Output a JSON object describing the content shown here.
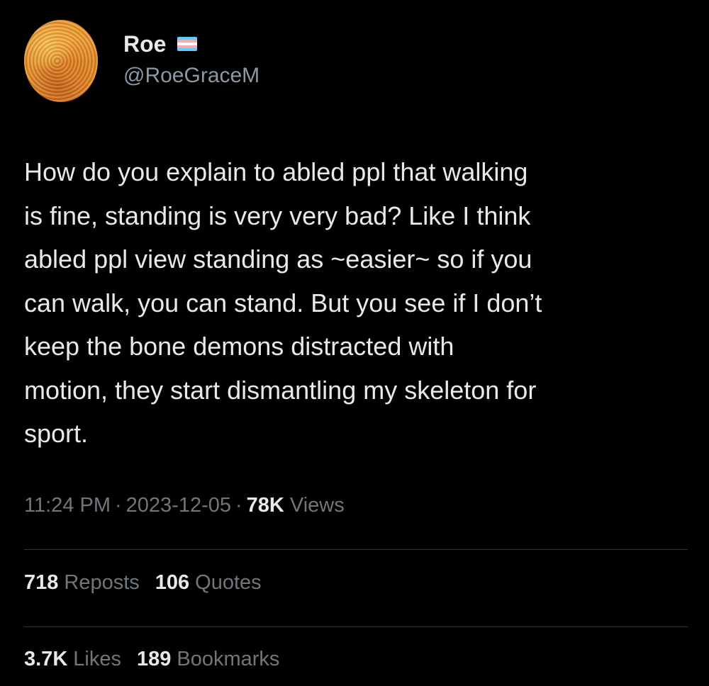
{
  "user": {
    "display_name": "Roe",
    "handle": "@RoeGraceM",
    "flag_icon": "trans-flag-icon",
    "flag_colors": [
      "#5bcefa",
      "#f5a9b8",
      "#ffffff",
      "#f5a9b8",
      "#5bcefa"
    ]
  },
  "tweet": {
    "text": "How do you explain to abled ppl that walking\nis fine, standing is very very bad? Like I think\nabled ppl view standing as ~easier~ so if you\ncan walk, you can stand. But you see if I don’t\nkeep the bone demons distracted with\nmotion, they start dismantling my skeleton for\nsport."
  },
  "meta": {
    "time": "11:24 PM",
    "separator": "·",
    "date": "2023-12-05",
    "views_count": "78K",
    "views_label": "Views"
  },
  "stats": {
    "reposts_count": "718",
    "reposts_label": "Reposts",
    "quotes_count": "106",
    "quotes_label": "Quotes",
    "likes_count": "3.7K",
    "likes_label": "Likes",
    "bookmarks_count": "189",
    "bookmarks_label": "Bookmarks"
  },
  "colors": {
    "background": "#000000",
    "text_primary": "#e7e9ea",
    "text_secondary": "#71767b",
    "divider": "#2f3336"
  }
}
